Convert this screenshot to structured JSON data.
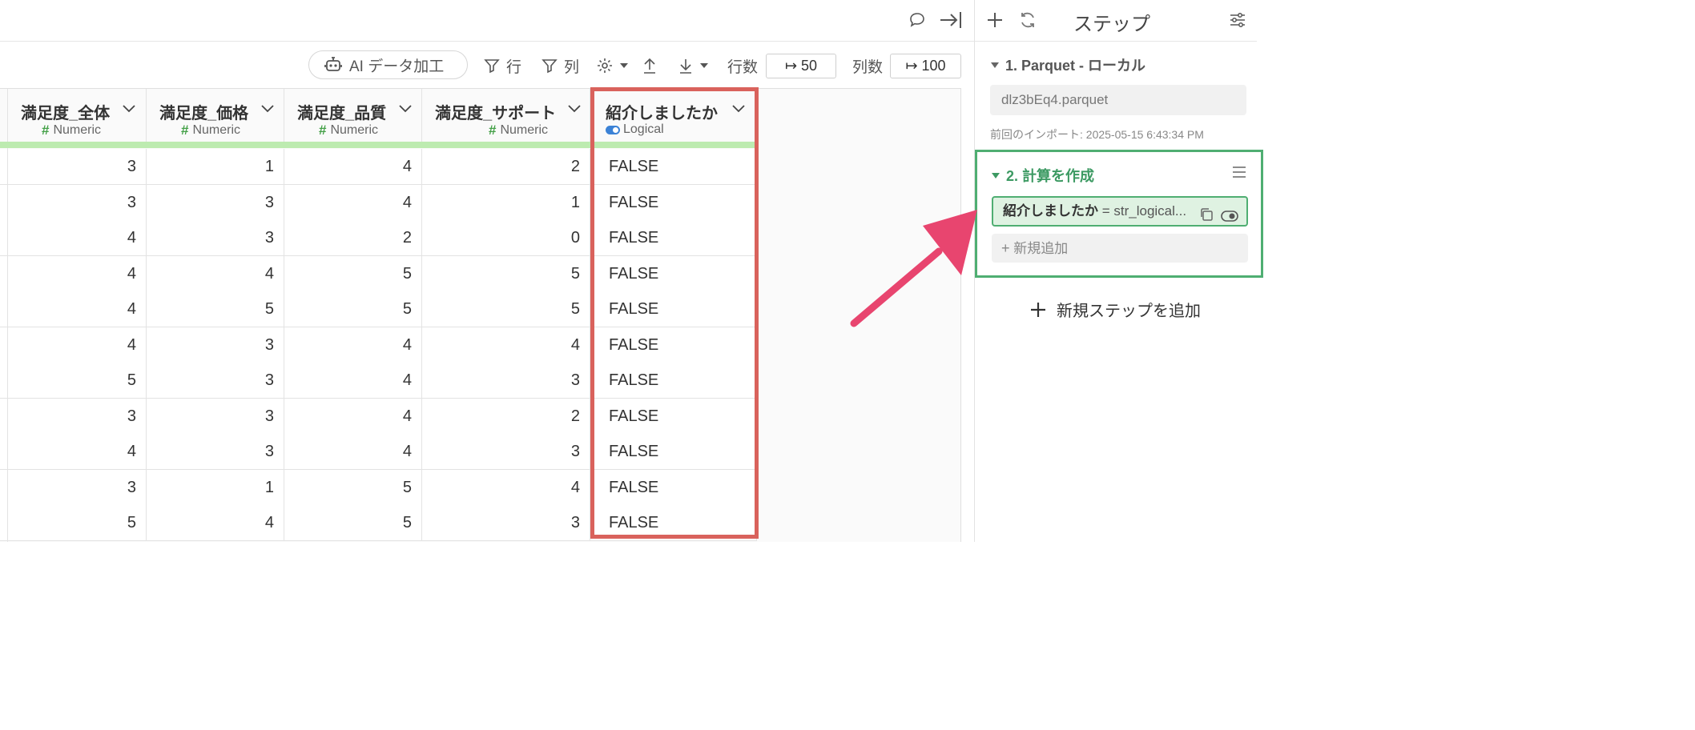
{
  "toolbar": {
    "ai_label": "AI データ加工",
    "row_filter_label": "行",
    "col_filter_label": "列",
    "rows_label": "行数",
    "rows_value": "↦ 50",
    "cols_label": "列数",
    "cols_value": "↦ 100"
  },
  "table": {
    "columns": [
      {
        "name": "満足度_全体",
        "type": "Numeric"
      },
      {
        "name": "満足度_価格",
        "type": "Numeric"
      },
      {
        "name": "満足度_品質",
        "type": "Numeric"
      },
      {
        "name": "満足度_サポート",
        "type": "Numeric"
      },
      {
        "name": "紹介しましたか",
        "type": "Logical"
      }
    ],
    "rows": [
      [
        "3",
        "1",
        "4",
        "2",
        "FALSE"
      ],
      [
        "3",
        "3",
        "4",
        "1",
        "FALSE"
      ],
      [
        "4",
        "3",
        "2",
        "0",
        "FALSE"
      ],
      [
        "4",
        "4",
        "5",
        "5",
        "FALSE"
      ],
      [
        "4",
        "5",
        "5",
        "5",
        "FALSE"
      ],
      [
        "4",
        "3",
        "4",
        "4",
        "FALSE"
      ],
      [
        "5",
        "3",
        "4",
        "3",
        "FALSE"
      ],
      [
        "3",
        "3",
        "4",
        "2",
        "FALSE"
      ],
      [
        "4",
        "3",
        "4",
        "3",
        "FALSE"
      ],
      [
        "3",
        "1",
        "5",
        "4",
        "FALSE"
      ],
      [
        "5",
        "4",
        "5",
        "3",
        "FALSE"
      ]
    ]
  },
  "panel": {
    "title": "ステップ",
    "step1": {
      "title": "1. Parquet - ローカル",
      "file": "dlz3bEq4.parquet",
      "last_import": "前回のインポート: 2025-05-15 6:43:34 PM"
    },
    "step2": {
      "title": "2. 計算を作成",
      "calc_name": "紹介しましたか",
      "calc_expr": "= str_logical...",
      "add_new": "新規追加"
    },
    "add_step": "新規ステップを追加"
  },
  "colors": {
    "accent_green": "#4fae72",
    "highlight_red": "#d9625c",
    "arrow_pink": "#e8456f",
    "numeric_bar": "#bdebb0"
  },
  "icons": [
    "comment-icon",
    "collapse-right-icon",
    "plus-icon",
    "refresh-icon",
    "settings-sliders-icon",
    "robot-icon",
    "filter-icon",
    "gear-icon",
    "upload-icon",
    "download-icon",
    "chevron-down-icon",
    "menu-icon",
    "copy-icon",
    "eye-icon"
  ]
}
